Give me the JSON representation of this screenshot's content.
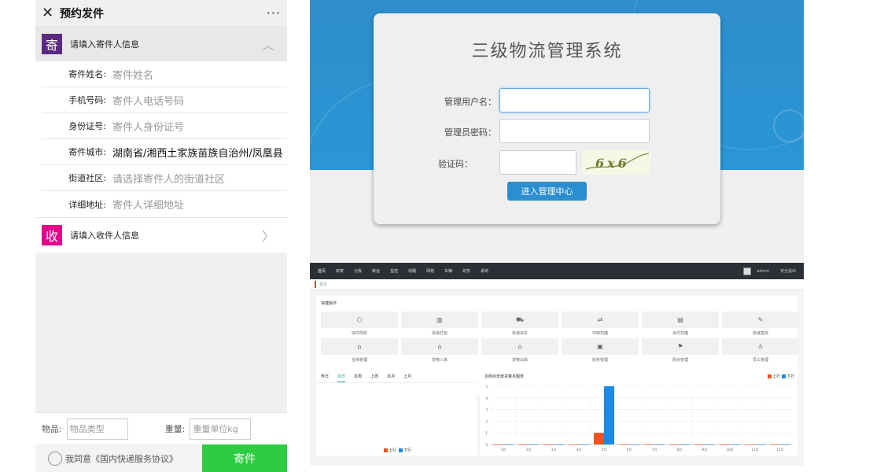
{
  "mobile": {
    "title": "预约发件",
    "close_icon": "close-icon",
    "more": "···",
    "sender_badge": "寄",
    "sender_title": "请填入寄件人信息",
    "receiver_badge": "收",
    "receiver_title": "请填入收件人信息",
    "fields": [
      {
        "label": "寄件姓名:",
        "value": "寄件姓名"
      },
      {
        "label": "手机号码:",
        "value": "寄件人电话号码"
      },
      {
        "label": "身份证号:",
        "value": "寄件人身份证号"
      },
      {
        "label": "寄件城市:",
        "value": "湖南省/湘西土家族苗族自治州/凤凰县"
      },
      {
        "label": "街道社区:",
        "value": "请选择寄件人的街道社区"
      },
      {
        "label": "详细地址:",
        "value": "寄件人详细地址"
      }
    ],
    "goods_label": "物品:",
    "goods_placeholder": "物品类型",
    "weight_label": "重量:",
    "weight_placeholder": "重量单位kg",
    "agree_text": "我同意《国内快递服务协议》",
    "submit": "寄件",
    "colors": {
      "sender_badge": "#5a2a82",
      "receiver_badge": "#e3008c",
      "submit": "#2ecc40"
    }
  },
  "login": {
    "title": "三级物流管理系统",
    "user_label": "管理用户名：",
    "pass_label": "管理员密码：",
    "code_label": "验证码：",
    "captcha_text": "6x6",
    "submit": "进入管理中心",
    "colors": {
      "header_bg": "#2a96d6",
      "button": "#2b8ed0"
    }
  },
  "dashboard": {
    "nav": [
      "首页",
      "收寄",
      "分拣",
      "转运",
      "监控",
      "线路",
      "网络",
      "车辆",
      "财务",
      "系统"
    ],
    "admin": "admin",
    "logout": "安全退出",
    "crumb": "首页",
    "quick_title": "快捷操作",
    "tiles": [
      {
        "label": "快件揽收",
        "icon": "box-icon"
      },
      {
        "label": "快递打包",
        "icon": "package-icon"
      },
      {
        "label": "快递派车",
        "icon": "truck-icon"
      },
      {
        "label": "中转扫描",
        "icon": "shuffle-icon"
      },
      {
        "label": "派件扫描",
        "icon": "scanner-icon"
      },
      {
        "label": "快递签收",
        "icon": "sign-icon"
      },
      {
        "label": "仓库管理",
        "icon": "warehouse-icon"
      },
      {
        "label": "货物入库",
        "icon": "house-in-icon"
      },
      {
        "label": "货物出库",
        "icon": "house-out-icon"
      },
      {
        "label": "财务管理",
        "icon": "finance-icon"
      },
      {
        "label": "网点管理",
        "icon": "network-icon"
      },
      {
        "label": "员工管理",
        "icon": "staff-icon"
      }
    ],
    "tabs": [
      "昨日",
      "本日",
      "本周",
      "上周",
      "本月",
      "上月"
    ],
    "active_tab": 1,
    "left_legend": [
      "上行",
      "下行"
    ],
    "chart_title": "本网点年度货量月图表"
  },
  "chart_data": {
    "type": "bar",
    "title": "本网点年度货量月图表",
    "categories": [
      "1月",
      "2月",
      "3月",
      "4月",
      "5月",
      "6月",
      "7月",
      "8月",
      "9月",
      "10月",
      "11月",
      "12月"
    ],
    "series": [
      {
        "name": "上行",
        "color": "#f4511e",
        "values": [
          0,
          0,
          0,
          0,
          1,
          0,
          0,
          0,
          0,
          0,
          0,
          0
        ]
      },
      {
        "name": "下行",
        "color": "#1e88e5",
        "values": [
          0,
          0,
          0,
          0,
          5,
          0,
          0,
          0,
          0,
          0,
          0,
          0
        ]
      }
    ],
    "yticks": [
      0,
      1,
      2,
      3,
      4,
      5
    ],
    "ylim": [
      0,
      5
    ],
    "legend_position": "top-right",
    "grid": true
  }
}
